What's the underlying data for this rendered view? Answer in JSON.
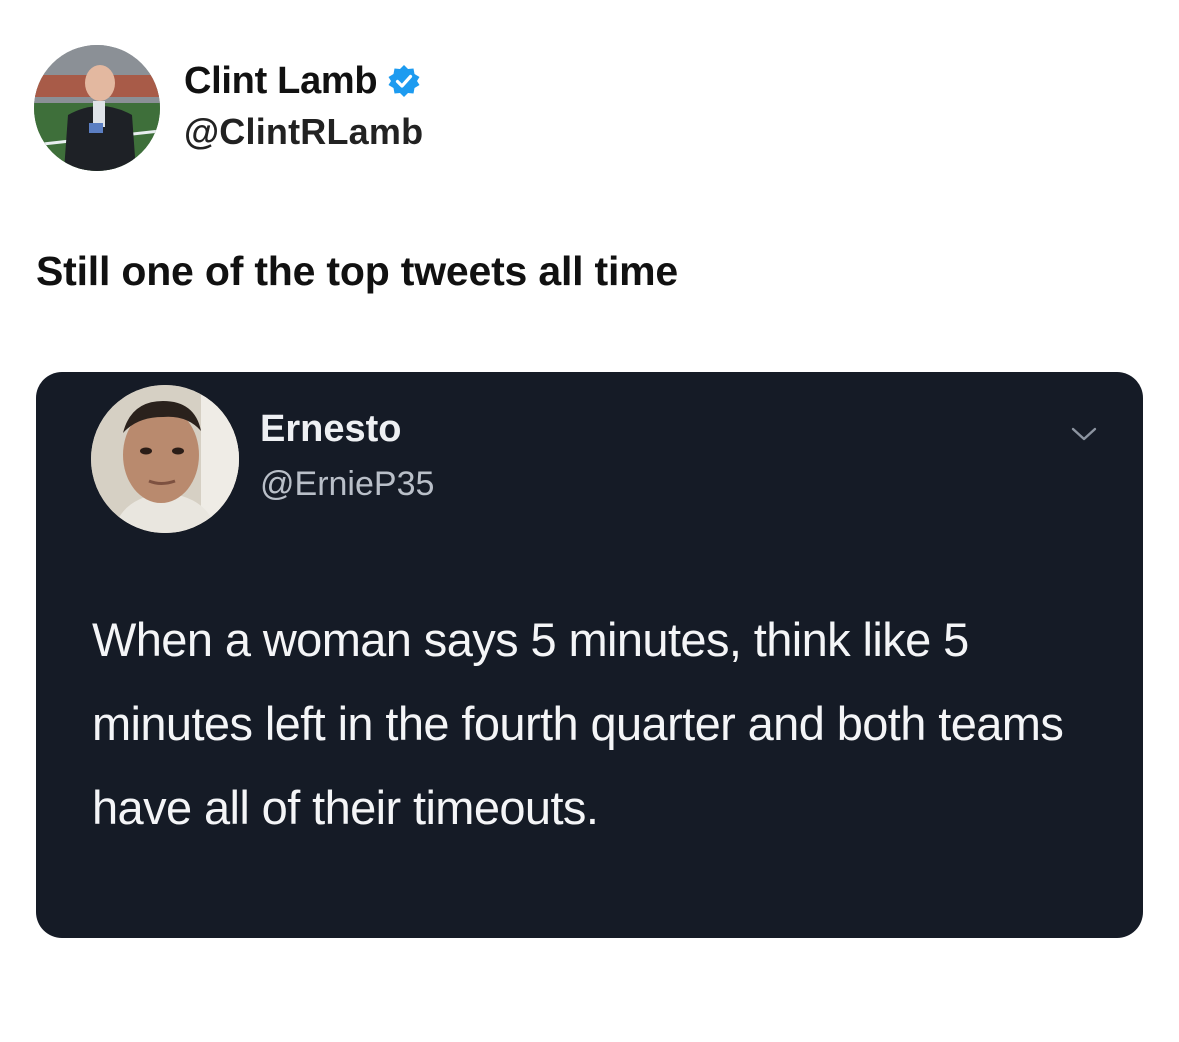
{
  "tweet": {
    "author": {
      "display_name": "Clint Lamb",
      "handle": "@ClintRLamb",
      "avatar_icon": "profile-photo",
      "verified_icon": "verified-badge-icon"
    },
    "text": "Still one of the top tweets all time"
  },
  "quoted_tweet": {
    "author": {
      "display_name": "Ernesto",
      "handle": "@ErnieP35",
      "avatar_icon": "profile-photo"
    },
    "menu_icon": "chevron-down-icon",
    "text": "When a woman says 5 minutes, think like 5 minutes left in the fourth quarter and both teams have all of their timeouts."
  },
  "colors": {
    "card_background": "#151b26",
    "verified_blue": "#1d9bf0"
  }
}
